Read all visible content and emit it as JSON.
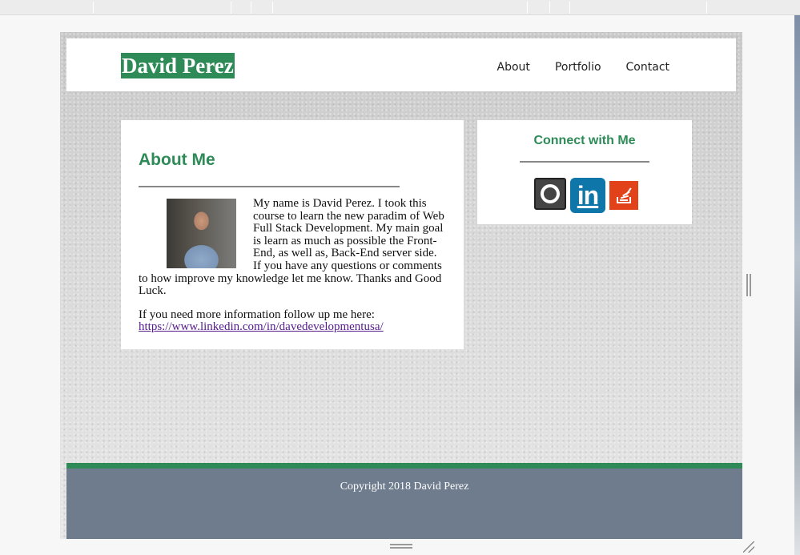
{
  "brand": {
    "name": "David Perez",
    "accent": "#2e8b57",
    "footer_bg": "#6f7c8e"
  },
  "nav": {
    "items": [
      {
        "label": "About"
      },
      {
        "label": "Portfolio"
      },
      {
        "label": "Contact"
      }
    ]
  },
  "about": {
    "title": "About Me",
    "bio": "My name is David Perez. I took this course to learn the new paradim of Web Full Stack Development. My main goal is learn as much as possible the Front-End, as well as, Back-End server side. If you have any questions or comments to how improve my knowledge let me know. Thanks and Good Luck.",
    "more_text": "If you need more information follow up me here:",
    "link": "https://www.linkedin.com/in/davedevelopmentusa/"
  },
  "connect": {
    "title": "Connect with Me",
    "icons": [
      "github-icon",
      "linkedin-icon",
      "stackoverflow-icon"
    ],
    "linkedin_text": "in"
  },
  "footer": {
    "copyright": "Copyright 2018 David Perez"
  }
}
